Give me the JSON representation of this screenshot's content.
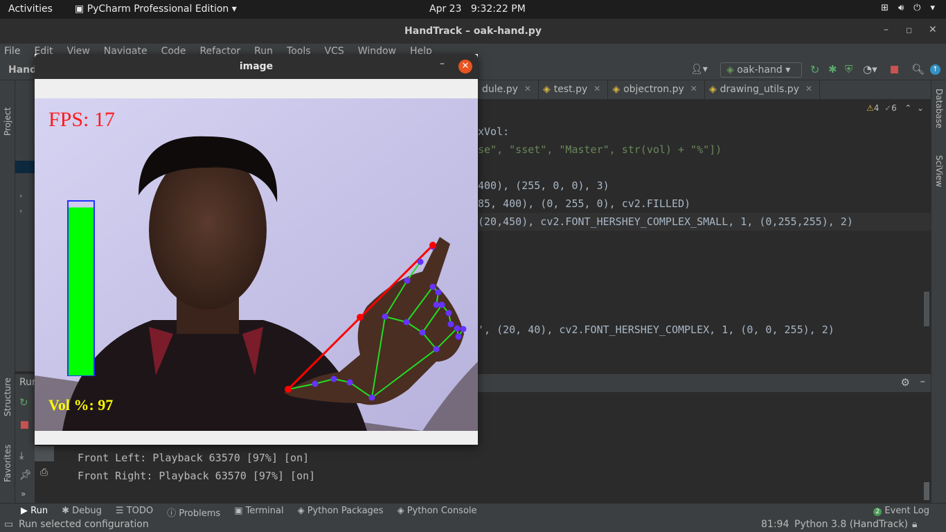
{
  "topbar": {
    "activities": "Activities",
    "app_name": "PyCharm Professional Edition",
    "date": "Apr 23",
    "time": "9:32:22 PM"
  },
  "window": {
    "title": "HandTrack – oak-hand.py"
  },
  "menu": [
    "File",
    "Edit",
    "View",
    "Navigate",
    "Code",
    "Refactor",
    "Run",
    "Tools",
    "VCS",
    "Window",
    "Help"
  ],
  "toolbar": {
    "project": "Hand",
    "run_config": "oak-hand"
  },
  "left_strip": {
    "project": "Project",
    "structure": "Structure",
    "favorites": "Favorites"
  },
  "right_strip": {
    "database": "Database",
    "sciview": "SciView"
  },
  "tabs": [
    {
      "label": "dule.py"
    },
    {
      "label": "test.py"
    },
    {
      "label": "objectron.py"
    },
    {
      "label": "drawing_utils.py"
    }
  ],
  "editor": {
    "warnings": "4",
    "weak_warnings": "6",
    "lines": [
      "xVol:",
      "se\", \"sset\", \"Master\", str(vol) + \"%\"])",
      "400), (255, 0, 0), 3)",
      "85, 400), (0, 255, 0), cv2.FILLED)",
      "(20,450), cv2.FONT_HERSHEY_COMPLEX_SMALL, 1, (0,255,255), 2)",
      "', (20, 40), cv2.FONT_HERSHEY_COMPLEX, 1, (0, 0, 255), 2)"
    ]
  },
  "run_panel": {
    "label": "Run",
    "output": [
      "Front Left: Playback 63570 [97%] [on]",
      "Front Right: Playback 63570 [97%] [on]"
    ]
  },
  "bottom_tabs": [
    "Run",
    "Debug",
    "TODO",
    "Problems",
    "Terminal",
    "Python Packages",
    "Python Console"
  ],
  "event_log": {
    "count": "2",
    "label": "Event Log"
  },
  "status": {
    "message": "Run selected configuration",
    "position": "81:94",
    "interpreter": "Python 3.8 (HandTrack)"
  },
  "image_window": {
    "title": "image",
    "fps_text": "FPS: 17",
    "vol_text": "Vol %: 97",
    "volume_level": 0.97
  },
  "colors": {
    "accent_close": "#e95420",
    "fps_text": "#ff1a1a",
    "vol_text": "#ffff00",
    "bar_fill": "#00ff00",
    "landmark": "#6633ff",
    "line_red": "#ff0000"
  }
}
